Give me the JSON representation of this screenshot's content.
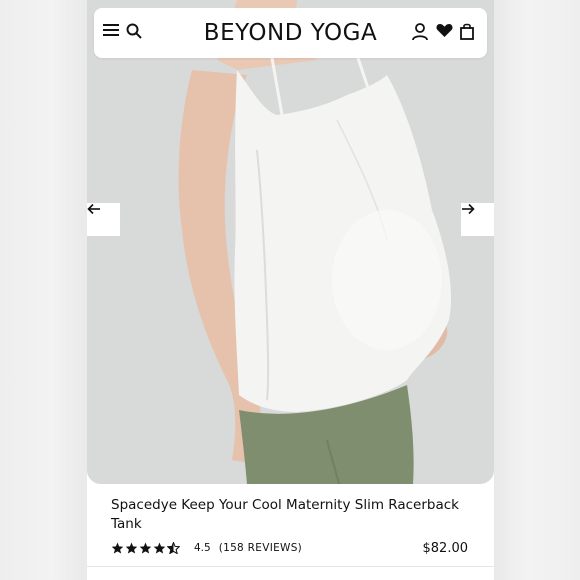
{
  "header": {
    "brand": "BEYOND YOGA",
    "icons": [
      "menu-icon",
      "search-icon",
      "account-icon",
      "wishlist-heart-icon",
      "shopping-bag-icon"
    ]
  },
  "carousel": {
    "prev_icon": "arrow-left-icon",
    "next_icon": "arrow-right-icon"
  },
  "product": {
    "title": "Spacedye Keep Your Cool Maternity Slim Racerback Tank",
    "rating": "4.5",
    "reviews": "(158 REVIEWS)",
    "price": "$82.00",
    "stars_value": 4.5,
    "stars_max": 5
  },
  "colors": {
    "tank": "#f4f4f2",
    "leggings": "#7f8e6f",
    "background": "#d8d9d9"
  }
}
